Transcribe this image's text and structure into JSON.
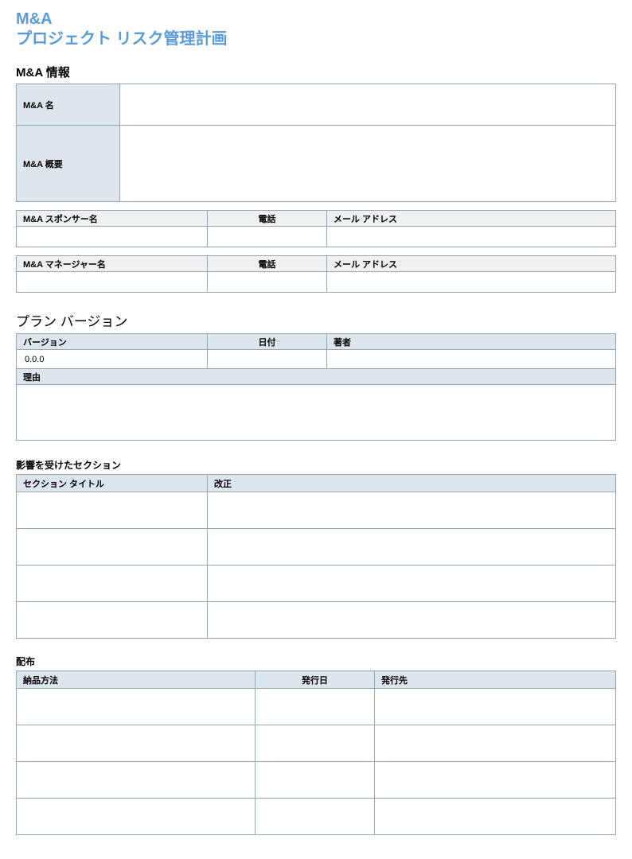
{
  "title": {
    "line1": "M&A",
    "line2": "プロジェクト リスク管理計画"
  },
  "info": {
    "heading": "M&A 情報",
    "name_label": "M&A 名",
    "name_value": "",
    "overview_label": "M&A 概要",
    "overview_value": ""
  },
  "sponsor": {
    "name_header": "M&A スポンサー名",
    "phone_header": "電話",
    "email_header": "メール アドレス",
    "name_value": "",
    "phone_value": "",
    "email_value": ""
  },
  "manager": {
    "name_header": "M&A マネージャー名",
    "phone_header": "電話",
    "email_header": "メール アドレス",
    "name_value": "",
    "phone_value": "",
    "email_value": ""
  },
  "version": {
    "heading": "プラン バージョン",
    "version_header": "バージョン",
    "date_header": "日付",
    "author_header": "著者",
    "version_value": "0.0.0",
    "date_value": "",
    "author_value": "",
    "reason_header": "理由",
    "reason_value": ""
  },
  "affected": {
    "heading": "影響を受けたセクション",
    "title_header": "セクション タイトル",
    "rev_header": "改正",
    "rows": [
      {
        "title": "",
        "rev": ""
      },
      {
        "title": "",
        "rev": ""
      },
      {
        "title": "",
        "rev": ""
      },
      {
        "title": "",
        "rev": ""
      }
    ]
  },
  "dist": {
    "heading": "配布",
    "method_header": "納品方法",
    "date_header": "発行日",
    "to_header": "発行先",
    "rows": [
      {
        "method": "",
        "date": "",
        "to": ""
      },
      {
        "method": "",
        "date": "",
        "to": ""
      },
      {
        "method": "",
        "date": "",
        "to": ""
      },
      {
        "method": "",
        "date": "",
        "to": ""
      }
    ]
  }
}
